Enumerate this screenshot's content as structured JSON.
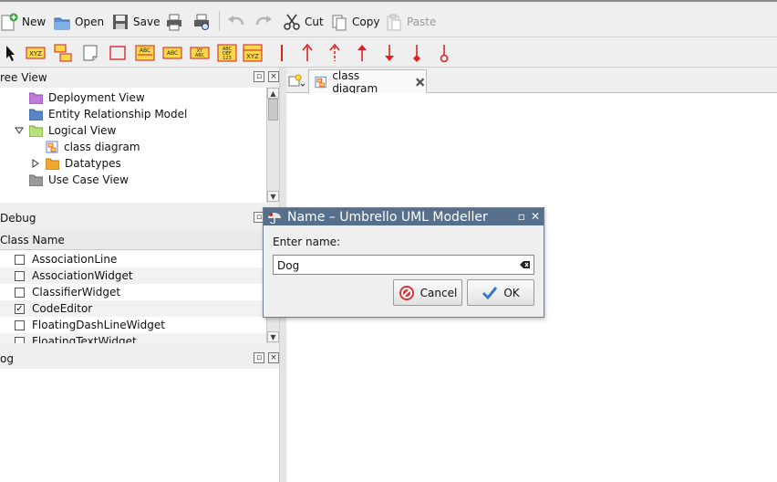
{
  "toolbar": {
    "new": "New",
    "open": "Open",
    "save": "Save",
    "cut": "Cut",
    "copy": "Copy",
    "paste": "Paste"
  },
  "tree_view": {
    "title": "ree View",
    "items": [
      {
        "label": "Deployment View"
      },
      {
        "label": "Entity Relationship Model"
      },
      {
        "label": "Logical View"
      },
      {
        "label": "class diagram"
      },
      {
        "label": "Datatypes"
      },
      {
        "label": "Use Case View"
      }
    ]
  },
  "debug": {
    "title": "Debug",
    "column": "Class Name",
    "rows": [
      {
        "label": "AssociationLine",
        "checked": false
      },
      {
        "label": "AssociationWidget",
        "checked": false
      },
      {
        "label": "ClassifierWidget",
        "checked": false
      },
      {
        "label": "CodeEditor",
        "checked": true
      },
      {
        "label": "FloatingDashLineWidget",
        "checked": false
      },
      {
        "label": "FloatingTextWidget",
        "checked": false
      }
    ]
  },
  "log": {
    "title": "og"
  },
  "tabs": [
    {
      "label": "class diagram"
    }
  ],
  "dialog": {
    "title": "Name – Umbrello UML Modeller",
    "prompt": "Enter name:",
    "value": "Dog",
    "cancel": "Cancel",
    "ok": "OK"
  },
  "colors": {
    "dialog_title_bg": "#556f8c",
    "tool_red": "#e02020"
  }
}
